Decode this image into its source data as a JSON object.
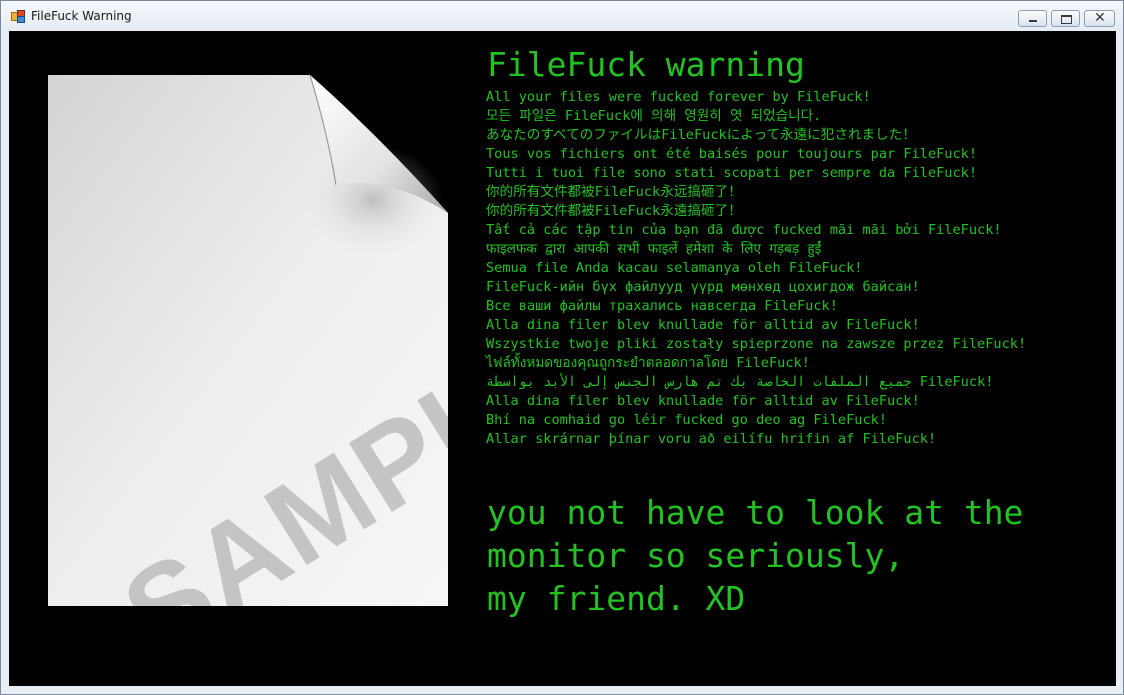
{
  "window": {
    "title": "FileFuck Warning",
    "controls": {
      "minimize": "minimize",
      "maximize": "maximize",
      "close": "✕"
    }
  },
  "image": {
    "icon": "document-page-curl-icon",
    "watermark": "SAMPLE BY"
  },
  "heading": "FileFuck warning",
  "messages": [
    "All your files were fucked forever by FileFuck!",
    "모든 파일은 FileFuck에 의해 영원히 엿 되었습니다.",
    "あなたのすべてのファイルはFileFuckによって永遠に犯されました！",
    "Tous vos fichiers ont été baisés pour toujours par FileFuck!",
    "Tutti i tuoi file sono stati scopati per sempre da FileFuck!",
    "你的所有文件都被FileFuck永远搞砸了！",
    "你的所有文件都被FileFuck永遠搞砸了！",
    "Tất cả các tập tin của bạn đã được fucked mãi mãi bởi FileFuck!",
    "फाइलफक द्वारा आपकी सभी फाइलें हमेशा के लिए गड़बड़ हुईं",
    "Semua file Anda kacau selamanya oleh FileFuck!",
    "FileFuck-ийн бүх файлууд үүрд мөнхөд цохигдож байсан!",
    "Все ваши файлы трахались навсегда FileFuck!",
    "Alla dina filer blev knullade för alltid av FileFuck!",
    "Wszystkie twoje pliki zostały spieprzone na zawsze przez FileFuck!",
    "ไฟล์ทั้งหมดของคุณถูกระยำตลอดกาลโดย FileFuck!",
    "جميع الملفات الخاصة بك تم هارس الجنس إلى الأبد بواسطة FileFuck!",
    "Alla dina filer blev knullade för alltid av FileFuck!",
    "Bhí na comhaid go léir fucked go deo ag FileFuck!",
    "Allar skrárnar þínar voru að eilífu hrifin af FileFuck!"
  ],
  "footer": {
    "line1": "you not have to look at the",
    "line2": "monitor so seriously,",
    "line3": "my friend. XD"
  },
  "colors": {
    "text": "#22c222",
    "background": "#000000",
    "chrome": "#e9eef5"
  }
}
